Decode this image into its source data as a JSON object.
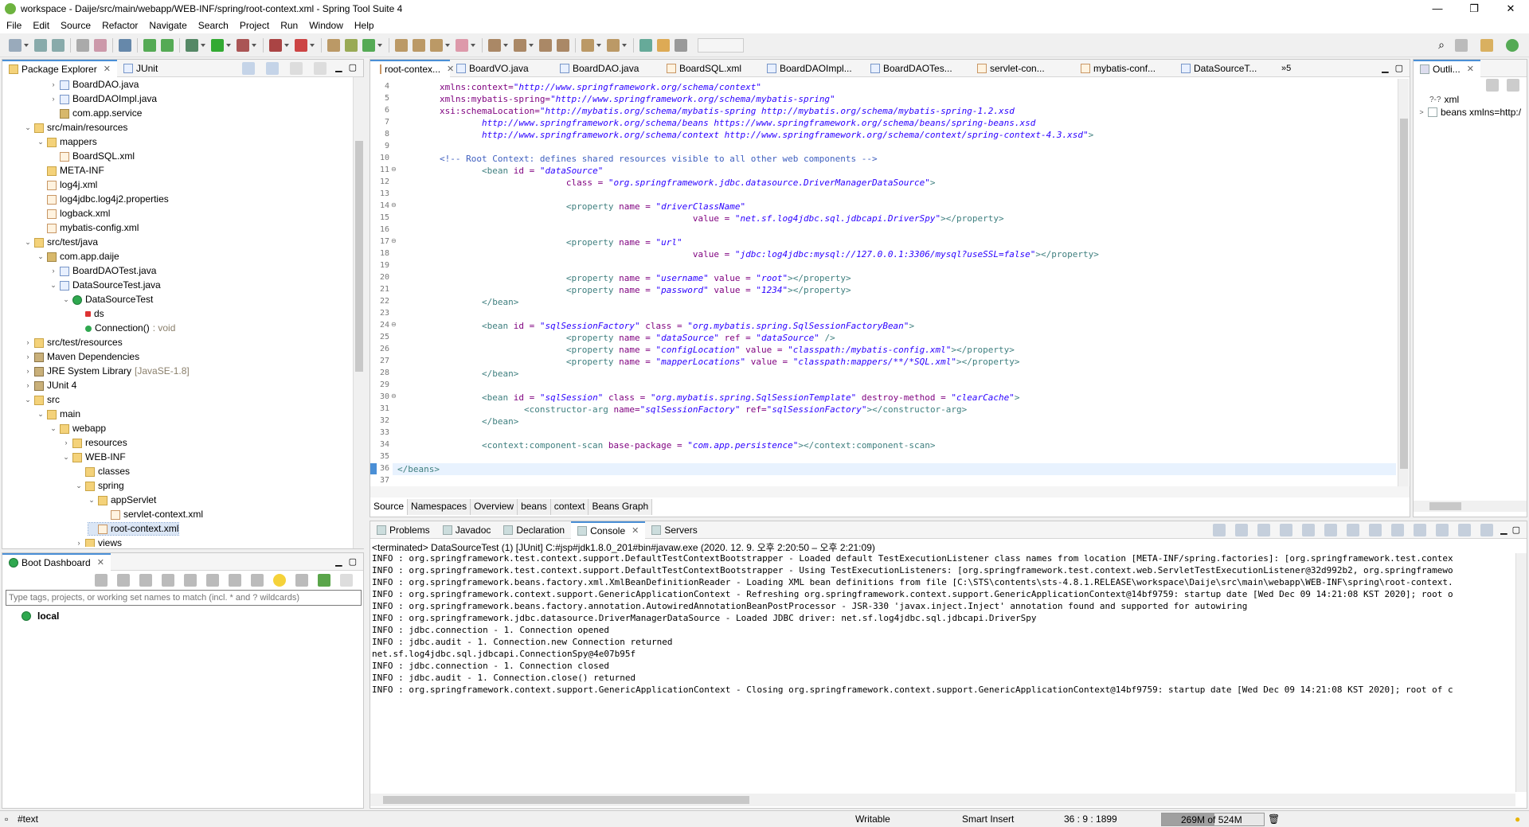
{
  "window": {
    "title": "workspace - Daije/src/main/webapp/WEB-INF/spring/root-context.xml - Spring Tool Suite 4",
    "controls": [
      "—",
      "❐",
      "✕"
    ]
  },
  "menu": [
    "File",
    "Edit",
    "Source",
    "Refactor",
    "Navigate",
    "Search",
    "Project",
    "Run",
    "Window",
    "Help"
  ],
  "package_explorer": {
    "tabs": [
      "Package Explorer",
      "JUnit"
    ],
    "tree": [
      {
        "d": 3,
        "tw": ">",
        "icon": "j",
        "label": "BoardDAO.java"
      },
      {
        "d": 3,
        "tw": ">",
        "icon": "j",
        "label": "BoardDAOImpl.java"
      },
      {
        "d": 3,
        "tw": "",
        "icon": "pkg",
        "label": "com.app.service"
      },
      {
        "d": 1,
        "tw": "v",
        "icon": "folder",
        "label": "src/main/resources"
      },
      {
        "d": 2,
        "tw": "v",
        "icon": "folder",
        "label": "mappers"
      },
      {
        "d": 3,
        "tw": "",
        "icon": "x",
        "label": "BoardSQL.xml"
      },
      {
        "d": 2,
        "tw": "",
        "icon": "folder",
        "label": "META-INF"
      },
      {
        "d": 2,
        "tw": "",
        "icon": "x",
        "label": "log4j.xml"
      },
      {
        "d": 2,
        "tw": "",
        "icon": "x",
        "label": "log4jdbc.log4j2.properties"
      },
      {
        "d": 2,
        "tw": "",
        "icon": "x",
        "label": "logback.xml"
      },
      {
        "d": 2,
        "tw": "",
        "icon": "x",
        "label": "mybatis-config.xml"
      },
      {
        "d": 1,
        "tw": "v",
        "icon": "folder",
        "label": "src/test/java"
      },
      {
        "d": 2,
        "tw": "v",
        "icon": "pkg",
        "label": "com.app.daije"
      },
      {
        "d": 3,
        "tw": ">",
        "icon": "j",
        "label": "BoardDAOTest.java"
      },
      {
        "d": 3,
        "tw": "v",
        "icon": "j",
        "label": "DataSourceTest.java"
      },
      {
        "d": 4,
        "tw": "v",
        "icon": "cls",
        "label": "DataSourceTest"
      },
      {
        "d": 5,
        "tw": "",
        "icon": "fld",
        "label": "ds"
      },
      {
        "d": 5,
        "tw": "",
        "icon": "mth",
        "label": "Connection()",
        "deco": " : void"
      },
      {
        "d": 1,
        "tw": ">",
        "icon": "folder",
        "label": "src/test/resources"
      },
      {
        "d": 1,
        "tw": ">",
        "icon": "lib",
        "label": "Maven Dependencies"
      },
      {
        "d": 1,
        "tw": ">",
        "icon": "lib",
        "label": "JRE System Library",
        "deco": " [JavaSE-1.8]"
      },
      {
        "d": 1,
        "tw": ">",
        "icon": "lib",
        "label": "JUnit 4"
      },
      {
        "d": 1,
        "tw": "v",
        "icon": "folder",
        "label": "src"
      },
      {
        "d": 2,
        "tw": "v",
        "icon": "folder",
        "label": "main"
      },
      {
        "d": 3,
        "tw": "v",
        "icon": "folder",
        "label": "webapp"
      },
      {
        "d": 4,
        "tw": ">",
        "icon": "folder",
        "label": "resources"
      },
      {
        "d": 4,
        "tw": "v",
        "icon": "folder",
        "label": "WEB-INF"
      },
      {
        "d": 5,
        "tw": "",
        "icon": "folder",
        "label": "classes"
      },
      {
        "d": 5,
        "tw": "v",
        "icon": "folder",
        "label": "spring"
      },
      {
        "d": 6,
        "tw": "v",
        "icon": "folder",
        "label": "appServlet"
      },
      {
        "d": 7,
        "tw": "",
        "icon": "x",
        "label": "servlet-context.xml"
      },
      {
        "d": 6,
        "tw": "",
        "icon": "x",
        "label": "root-context.xml",
        "selected": true
      },
      {
        "d": 5,
        "tw": ">",
        "icon": "folder",
        "label": "views"
      }
    ]
  },
  "boot_dashboard": {
    "tab": "Boot Dashboard",
    "filter_placeholder": "Type tags, projects, or working set names to match (incl. * and ? wildcards)",
    "items": [
      "local"
    ]
  },
  "editor": {
    "tabs": [
      "root-contex...",
      "BoardVO.java",
      "BoardDAO.java",
      "BoardSQL.xml",
      "BoardDAOImpl...",
      "BoardDAOTes...",
      "servlet-con...",
      "mybatis-conf...",
      "DataSourceT..."
    ],
    "overflow": "»5",
    "lines": [
      {
        "n": "4",
        "segs": [
          [
            "a",
            "\txmlns:context="
          ],
          [
            "v",
            "\"http://www.springframework.org/schema/context\""
          ]
        ]
      },
      {
        "n": "5",
        "segs": [
          [
            "a",
            "\txmlns:mybatis-spring="
          ],
          [
            "v",
            "\"http://www.springframework.org/schema/mybatis-spring\""
          ]
        ]
      },
      {
        "n": "6",
        "segs": [
          [
            "a",
            "\txsi:schemaLocation="
          ],
          [
            "v",
            "\"http://mybatis.org/schema/mybatis-spring http://mybatis.org/schema/mybatis-spring-1.2.xsd"
          ]
        ]
      },
      {
        "n": "7",
        "segs": [
          [
            "v",
            "\t\thttp://www.springframework.org/schema/beans https://www.springframework.org/schema/beans/spring-beans.xsd"
          ]
        ]
      },
      {
        "n": "8",
        "segs": [
          [
            "v",
            "\t\thttp://www.springframework.org/schema/context http://www.springframework.org/schema/context/spring-context-4.3.xsd\""
          ],
          [
            "t",
            ">"
          ]
        ]
      },
      {
        "n": "9",
        "segs": []
      },
      {
        "n": "10",
        "segs": [
          [
            "c",
            "\t<!-- Root Context: defines shared resources visible to all other web components -->"
          ]
        ]
      },
      {
        "n": "11",
        "fold": true,
        "segs": [
          [
            "t",
            "\t\t<bean "
          ],
          [
            "a",
            "id = "
          ],
          [
            "v",
            "\"dataSource\""
          ]
        ]
      },
      {
        "n": "12",
        "segs": [
          [
            "a",
            "\t\t\t\tclass = "
          ],
          [
            "v",
            "\"org.springframework.jdbc.datasource.DriverManagerDataSource\""
          ],
          [
            "t",
            ">"
          ]
        ]
      },
      {
        "n": "13",
        "segs": []
      },
      {
        "n": "14",
        "fold": true,
        "segs": [
          [
            "t",
            "\t\t\t\t<property "
          ],
          [
            "a",
            "name = "
          ],
          [
            "v",
            "\"driverClassName\""
          ]
        ]
      },
      {
        "n": "15",
        "segs": [
          [
            "a",
            "\t\t\t\t\t\t\tvalue = "
          ],
          [
            "v",
            "\"net.sf.log4jdbc.sql.jdbcapi.DriverSpy\""
          ],
          [
            "t",
            "></property>"
          ]
        ]
      },
      {
        "n": "16",
        "segs": []
      },
      {
        "n": "17",
        "fold": true,
        "segs": [
          [
            "t",
            "\t\t\t\t<property "
          ],
          [
            "a",
            "name = "
          ],
          [
            "v",
            "\"url\""
          ]
        ]
      },
      {
        "n": "18",
        "segs": [
          [
            "a",
            "\t\t\t\t\t\t\tvalue = "
          ],
          [
            "v",
            "\"jdbc:log4jdbc:mysql://127.0.0.1:3306/mysql?useSSL=false\""
          ],
          [
            "t",
            "></property>"
          ]
        ]
      },
      {
        "n": "19",
        "segs": []
      },
      {
        "n": "20",
        "segs": [
          [
            "t",
            "\t\t\t\t<property "
          ],
          [
            "a",
            "name = "
          ],
          [
            "v",
            "\"username\" "
          ],
          [
            "a",
            "value = "
          ],
          [
            "v",
            "\"root\""
          ],
          [
            "t",
            "></property>"
          ]
        ]
      },
      {
        "n": "21",
        "segs": [
          [
            "t",
            "\t\t\t\t<property "
          ],
          [
            "a",
            "name = "
          ],
          [
            "v",
            "\"password\" "
          ],
          [
            "a",
            "value = "
          ],
          [
            "v",
            "\"1234\""
          ],
          [
            "t",
            "></property>"
          ]
        ]
      },
      {
        "n": "22",
        "segs": [
          [
            "t",
            "\t\t</bean>"
          ]
        ]
      },
      {
        "n": "23",
        "segs": []
      },
      {
        "n": "24",
        "fold": true,
        "segs": [
          [
            "t",
            "\t\t<bean "
          ],
          [
            "a",
            "id = "
          ],
          [
            "v",
            "\"sqlSessionFactory\" "
          ],
          [
            "a",
            "class = "
          ],
          [
            "v",
            "\"org.mybatis.spring.SqlSessionFactoryBean\""
          ],
          [
            "t",
            ">"
          ]
        ]
      },
      {
        "n": "25",
        "segs": [
          [
            "t",
            "\t\t\t\t<property "
          ],
          [
            "a",
            "name = "
          ],
          [
            "v",
            "\"dataSource\" "
          ],
          [
            "a",
            "ref = "
          ],
          [
            "v",
            "\"dataSource\""
          ],
          [
            "t",
            " />"
          ]
        ]
      },
      {
        "n": "26",
        "segs": [
          [
            "t",
            "\t\t\t\t<property "
          ],
          [
            "a",
            "name = "
          ],
          [
            "v",
            "\"configLocation\" "
          ],
          [
            "a",
            "value = "
          ],
          [
            "v",
            "\"classpath:/mybatis-config.xml\""
          ],
          [
            "t",
            "></property>"
          ]
        ]
      },
      {
        "n": "27",
        "segs": [
          [
            "t",
            "\t\t\t\t<property "
          ],
          [
            "a",
            "name = "
          ],
          [
            "v",
            "\"mapperLocations\" "
          ],
          [
            "a",
            "value = "
          ],
          [
            "v",
            "\"classpath:mappers/**/*SQL.xml\""
          ],
          [
            "t",
            "></property>"
          ]
        ]
      },
      {
        "n": "28",
        "segs": [
          [
            "t",
            "\t\t</bean>"
          ]
        ]
      },
      {
        "n": "29",
        "segs": []
      },
      {
        "n": "30",
        "fold": true,
        "segs": [
          [
            "t",
            "\t\t<bean "
          ],
          [
            "a",
            "id = "
          ],
          [
            "v",
            "\"sqlSession\" "
          ],
          [
            "a",
            "class = "
          ],
          [
            "v",
            "\"org.mybatis.spring.SqlSessionTemplate\" "
          ],
          [
            "a",
            "destroy-method = "
          ],
          [
            "v",
            "\"clearCache\""
          ],
          [
            "t",
            ">"
          ]
        ]
      },
      {
        "n": "31",
        "segs": [
          [
            "t",
            "\t\t\t<constructor-arg "
          ],
          [
            "a",
            "name="
          ],
          [
            "v",
            "\"sqlSessionFactory\" "
          ],
          [
            "a",
            "ref="
          ],
          [
            "v",
            "\"sqlSessionFactory\""
          ],
          [
            "t",
            "></constructor-arg>"
          ]
        ]
      },
      {
        "n": "32",
        "segs": [
          [
            "t",
            "\t\t</bean>"
          ]
        ]
      },
      {
        "n": "33",
        "segs": []
      },
      {
        "n": "34",
        "segs": [
          [
            "t",
            "\t\t<context:component-scan "
          ],
          [
            "a",
            "base-package = "
          ],
          [
            "v",
            "\"com.app.persistence\""
          ],
          [
            "t",
            "></context:component-scan>"
          ]
        ]
      },
      {
        "n": "35",
        "segs": []
      },
      {
        "n": "36",
        "current": true,
        "segs": [
          [
            "t",
            "</beans>"
          ]
        ]
      },
      {
        "n": "37",
        "segs": []
      }
    ],
    "bottom_tabs": [
      "Source",
      "Namespaces",
      "Overview",
      "beans",
      "context",
      "Beans Graph"
    ]
  },
  "outline": {
    "tab": "Outli...",
    "items": [
      {
        "icon": "?-?",
        "label": "xml"
      },
      {
        "icon": "e",
        "label": "beans xmlns=http:/"
      }
    ]
  },
  "console": {
    "tabs": [
      "Problems",
      "Javadoc",
      "Declaration",
      "Console",
      "Servers"
    ],
    "header": "<terminated> DataSourceTest (1) [JUnit] C:#jsp#jdk1.8.0_201#bin#javaw.exe  (2020. 12. 9. 오후 2:20:50 – 오후 2:21:09)",
    "lines": [
      "INFO : org.springframework.test.context.support.DefaultTestContextBootstrapper - Loaded default TestExecutionListener class names from location [META-INF/spring.factories]: [org.springframework.test.contex",
      "INFO : org.springframework.test.context.support.DefaultTestContextBootstrapper - Using TestExecutionListeners: [org.springframework.test.context.web.ServletTestExecutionListener@32d992b2, org.springframewo",
      "INFO : org.springframework.beans.factory.xml.XmlBeanDefinitionReader - Loading XML bean definitions from file [C:\\STS\\contents\\sts-4.8.1.RELEASE\\workspace\\Daije\\src\\main\\webapp\\WEB-INF\\spring\\root-context.",
      "INFO : org.springframework.context.support.GenericApplicationContext - Refreshing org.springframework.context.support.GenericApplicationContext@14bf9759: startup date [Wed Dec 09 14:21:08 KST 2020]; root o",
      "INFO : org.springframework.beans.factory.annotation.AutowiredAnnotationBeanPostProcessor - JSR-330 'javax.inject.Inject' annotation found and supported for autowiring",
      "INFO : org.springframework.jdbc.datasource.DriverManagerDataSource - Loaded JDBC driver: net.sf.log4jdbc.sql.jdbcapi.DriverSpy",
      "INFO : jdbc.connection - 1. Connection opened",
      "INFO : jdbc.audit - 1. Connection.new Connection returned",
      "net.sf.log4jdbc.sql.jdbcapi.ConnectionSpy@4e07b95f",
      "INFO : jdbc.connection - 1. Connection closed",
      "INFO : jdbc.audit - 1. Connection.close() returned",
      "INFO : org.springframework.context.support.GenericApplicationContext - Closing org.springframework.context.support.GenericApplicationContext@14bf9759: startup date [Wed Dec 09 14:21:08 KST 2020]; root of c"
    ]
  },
  "status": {
    "left": "#text",
    "mode": "Writable",
    "insert": "Smart Insert",
    "position": "36 : 9 : 1899",
    "memory": "269M of 524M",
    "memory_used_fraction": 0.513
  }
}
